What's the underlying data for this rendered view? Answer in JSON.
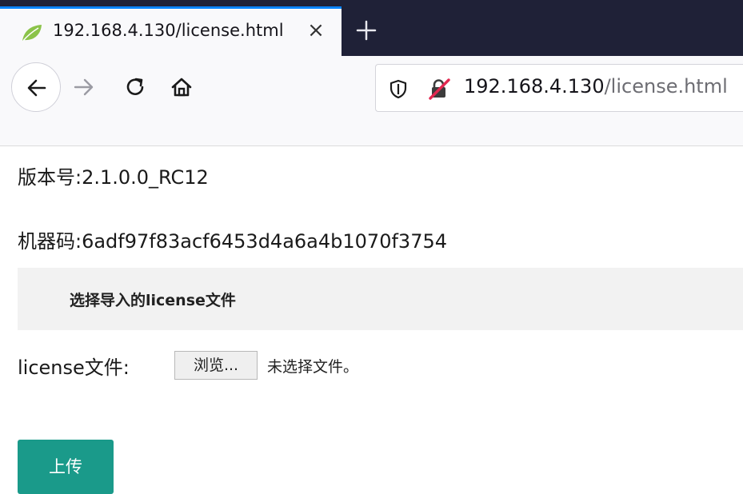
{
  "browser": {
    "tab_title": "192.168.4.130/license.html",
    "tab_close": "×",
    "url_host": "192.168.4.130",
    "url_path": "/license.html",
    "colors": {
      "tabstrip_bg": "#1f2137",
      "tab_accent": "#0a84ff",
      "toolbar_bg": "#f9f9fb"
    },
    "icons": [
      "spring-leaf-favicon-icon",
      "close-icon",
      "plus-icon",
      "back-arrow-icon",
      "forward-arrow-icon",
      "reload-icon",
      "home-icon",
      "shield-icon",
      "insecure-lock-icon"
    ]
  },
  "page": {
    "version_line": "版本号:2.1.0.0_RC12",
    "machine_line": "机器码:6adf97f83acf6453d4a6a4b1070f3754",
    "panel_title": "选择导入的license文件",
    "file_label": "license文件:",
    "browse_button": "浏览...",
    "file_status": "未选择文件。",
    "upload_button": "上传",
    "colors": {
      "upload_button_bg": "#1a9a8a",
      "panel_bg": "#f2f2f2"
    }
  }
}
